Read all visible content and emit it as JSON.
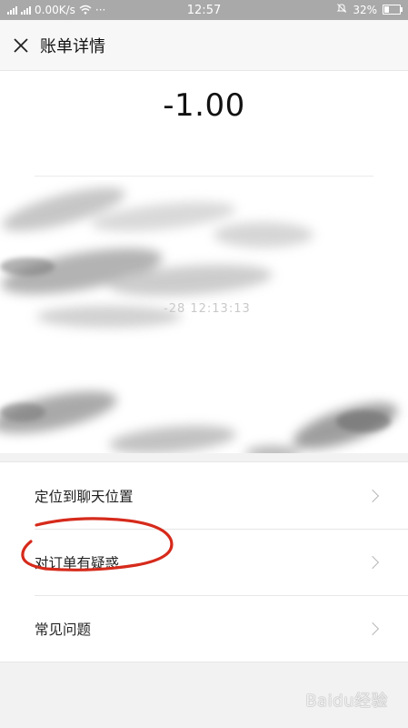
{
  "status_bar": {
    "network_speed": "0.00K/s",
    "more": "···",
    "time": "12:57",
    "battery": "32%",
    "battery_level": 0.32
  },
  "header": {
    "close_icon": "close-icon",
    "title": "账单详情"
  },
  "bill": {
    "amount": "-1.00",
    "time_partial": "-28 12:13:13"
  },
  "menu": {
    "items": [
      {
        "label": "定位到聊天位置"
      },
      {
        "label": "对订单有疑惑"
      },
      {
        "label": "常见问题"
      }
    ]
  },
  "watermark": {
    "text": "Baidu经验"
  },
  "colors": {
    "annotation": "#d62a1b",
    "status_bar": "#a9a9a9"
  }
}
